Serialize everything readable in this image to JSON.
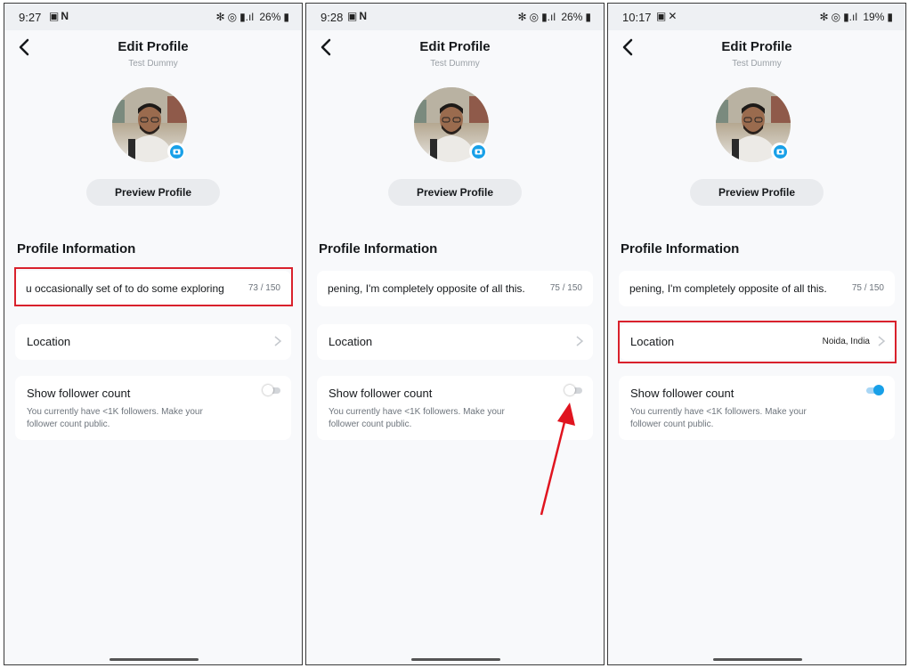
{
  "screens": [
    {
      "status": {
        "time": "9:27",
        "battery": "26%",
        "signal_label": "Vo))\nLTE1"
      },
      "header": {
        "title": "Edit Profile",
        "subtitle": "Test Dummy"
      },
      "preview_button": "Preview Profile",
      "section_title": "Profile Information",
      "bio": {
        "text": "u occasionally set of to do some exploring",
        "count": "73 / 150"
      },
      "location": {
        "label": "Location",
        "value": ""
      },
      "follower": {
        "label": "Show follower count",
        "description": "You currently have <1K followers. Make your follower count public.",
        "enabled": false
      }
    },
    {
      "status": {
        "time": "9:28",
        "battery": "26%",
        "signal_label": "Vo))\nLTE1"
      },
      "header": {
        "title": "Edit Profile",
        "subtitle": "Test Dummy"
      },
      "preview_button": "Preview Profile",
      "section_title": "Profile Information",
      "bio": {
        "text": "pening, I'm completely opposite of all this.",
        "count": "75 / 150"
      },
      "location": {
        "label": "Location",
        "value": ""
      },
      "follower": {
        "label": "Show follower count",
        "description": "You currently have <1K followers. Make your follower count public.",
        "enabled": false
      }
    },
    {
      "status": {
        "time": "10:17",
        "battery": "19%",
        "signal_label": "Vo))\nLTE1"
      },
      "header": {
        "title": "Edit Profile",
        "subtitle": "Test Dummy"
      },
      "preview_button": "Preview Profile",
      "section_title": "Profile Information",
      "bio": {
        "text": "pening, I'm completely opposite of all this.",
        "count": "75 / 150"
      },
      "location": {
        "label": "Location",
        "value": "Noida, India"
      },
      "follower": {
        "label": "Show follower count",
        "description": "You currently have <1K followers. Make your follower count public.",
        "enabled": true
      }
    }
  ],
  "colors": {
    "accent": "#18a0e8",
    "highlight": "#d9212c",
    "background": "#f8f9fb",
    "card": "#ffffff"
  },
  "icons": [
    "back-arrow-icon",
    "camera-icon",
    "chevron-right-icon",
    "bluetooth-icon",
    "hotspot-icon",
    "signal-icon",
    "battery-icon",
    "gallery-icon",
    "netflix-icon"
  ]
}
